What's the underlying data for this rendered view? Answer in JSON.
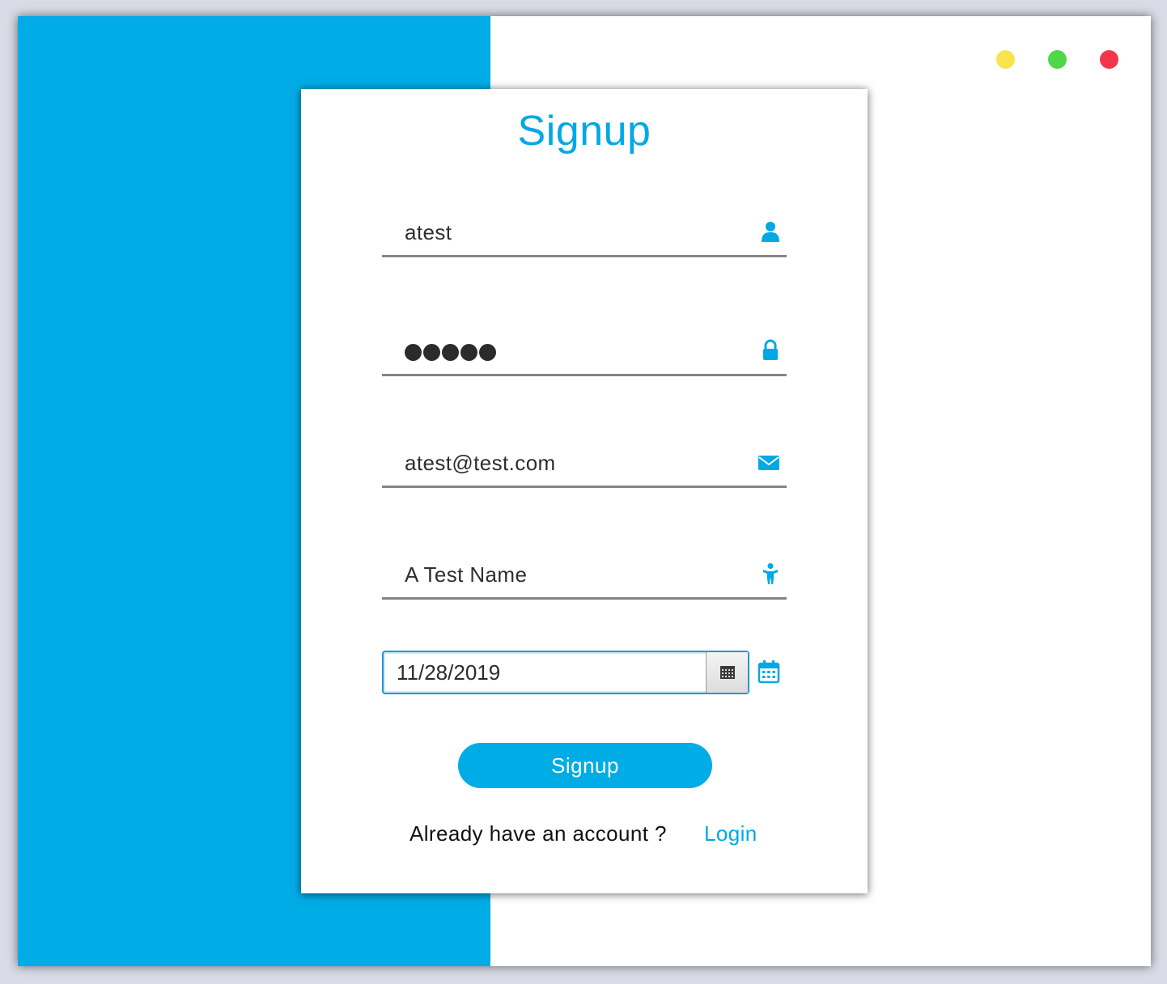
{
  "colors": {
    "accent": "#00ace6",
    "window_bg": "#ffffff",
    "dot_yellow": "#f7e34e",
    "dot_green": "#4fd64a",
    "dot_red": "#f2374a"
  },
  "window_controls": [
    "minimize-dot",
    "maximize-dot",
    "close-dot"
  ],
  "form": {
    "title": "Signup",
    "username": {
      "value": "atest",
      "icon": "user-icon"
    },
    "password": {
      "masked_length": 5,
      "icon": "lock-icon"
    },
    "email": {
      "value": "atest@test.com",
      "icon": "envelope-icon"
    },
    "full_name": {
      "value": "A Test Name",
      "icon": "person-icon"
    },
    "birthdate": {
      "value": "11/28/2019",
      "picker_icon": "calendar-grid-icon",
      "side_icon": "calendar-icon"
    },
    "submit_label": "Signup",
    "already_text": "Already have an account ?",
    "login_label": "Login"
  }
}
